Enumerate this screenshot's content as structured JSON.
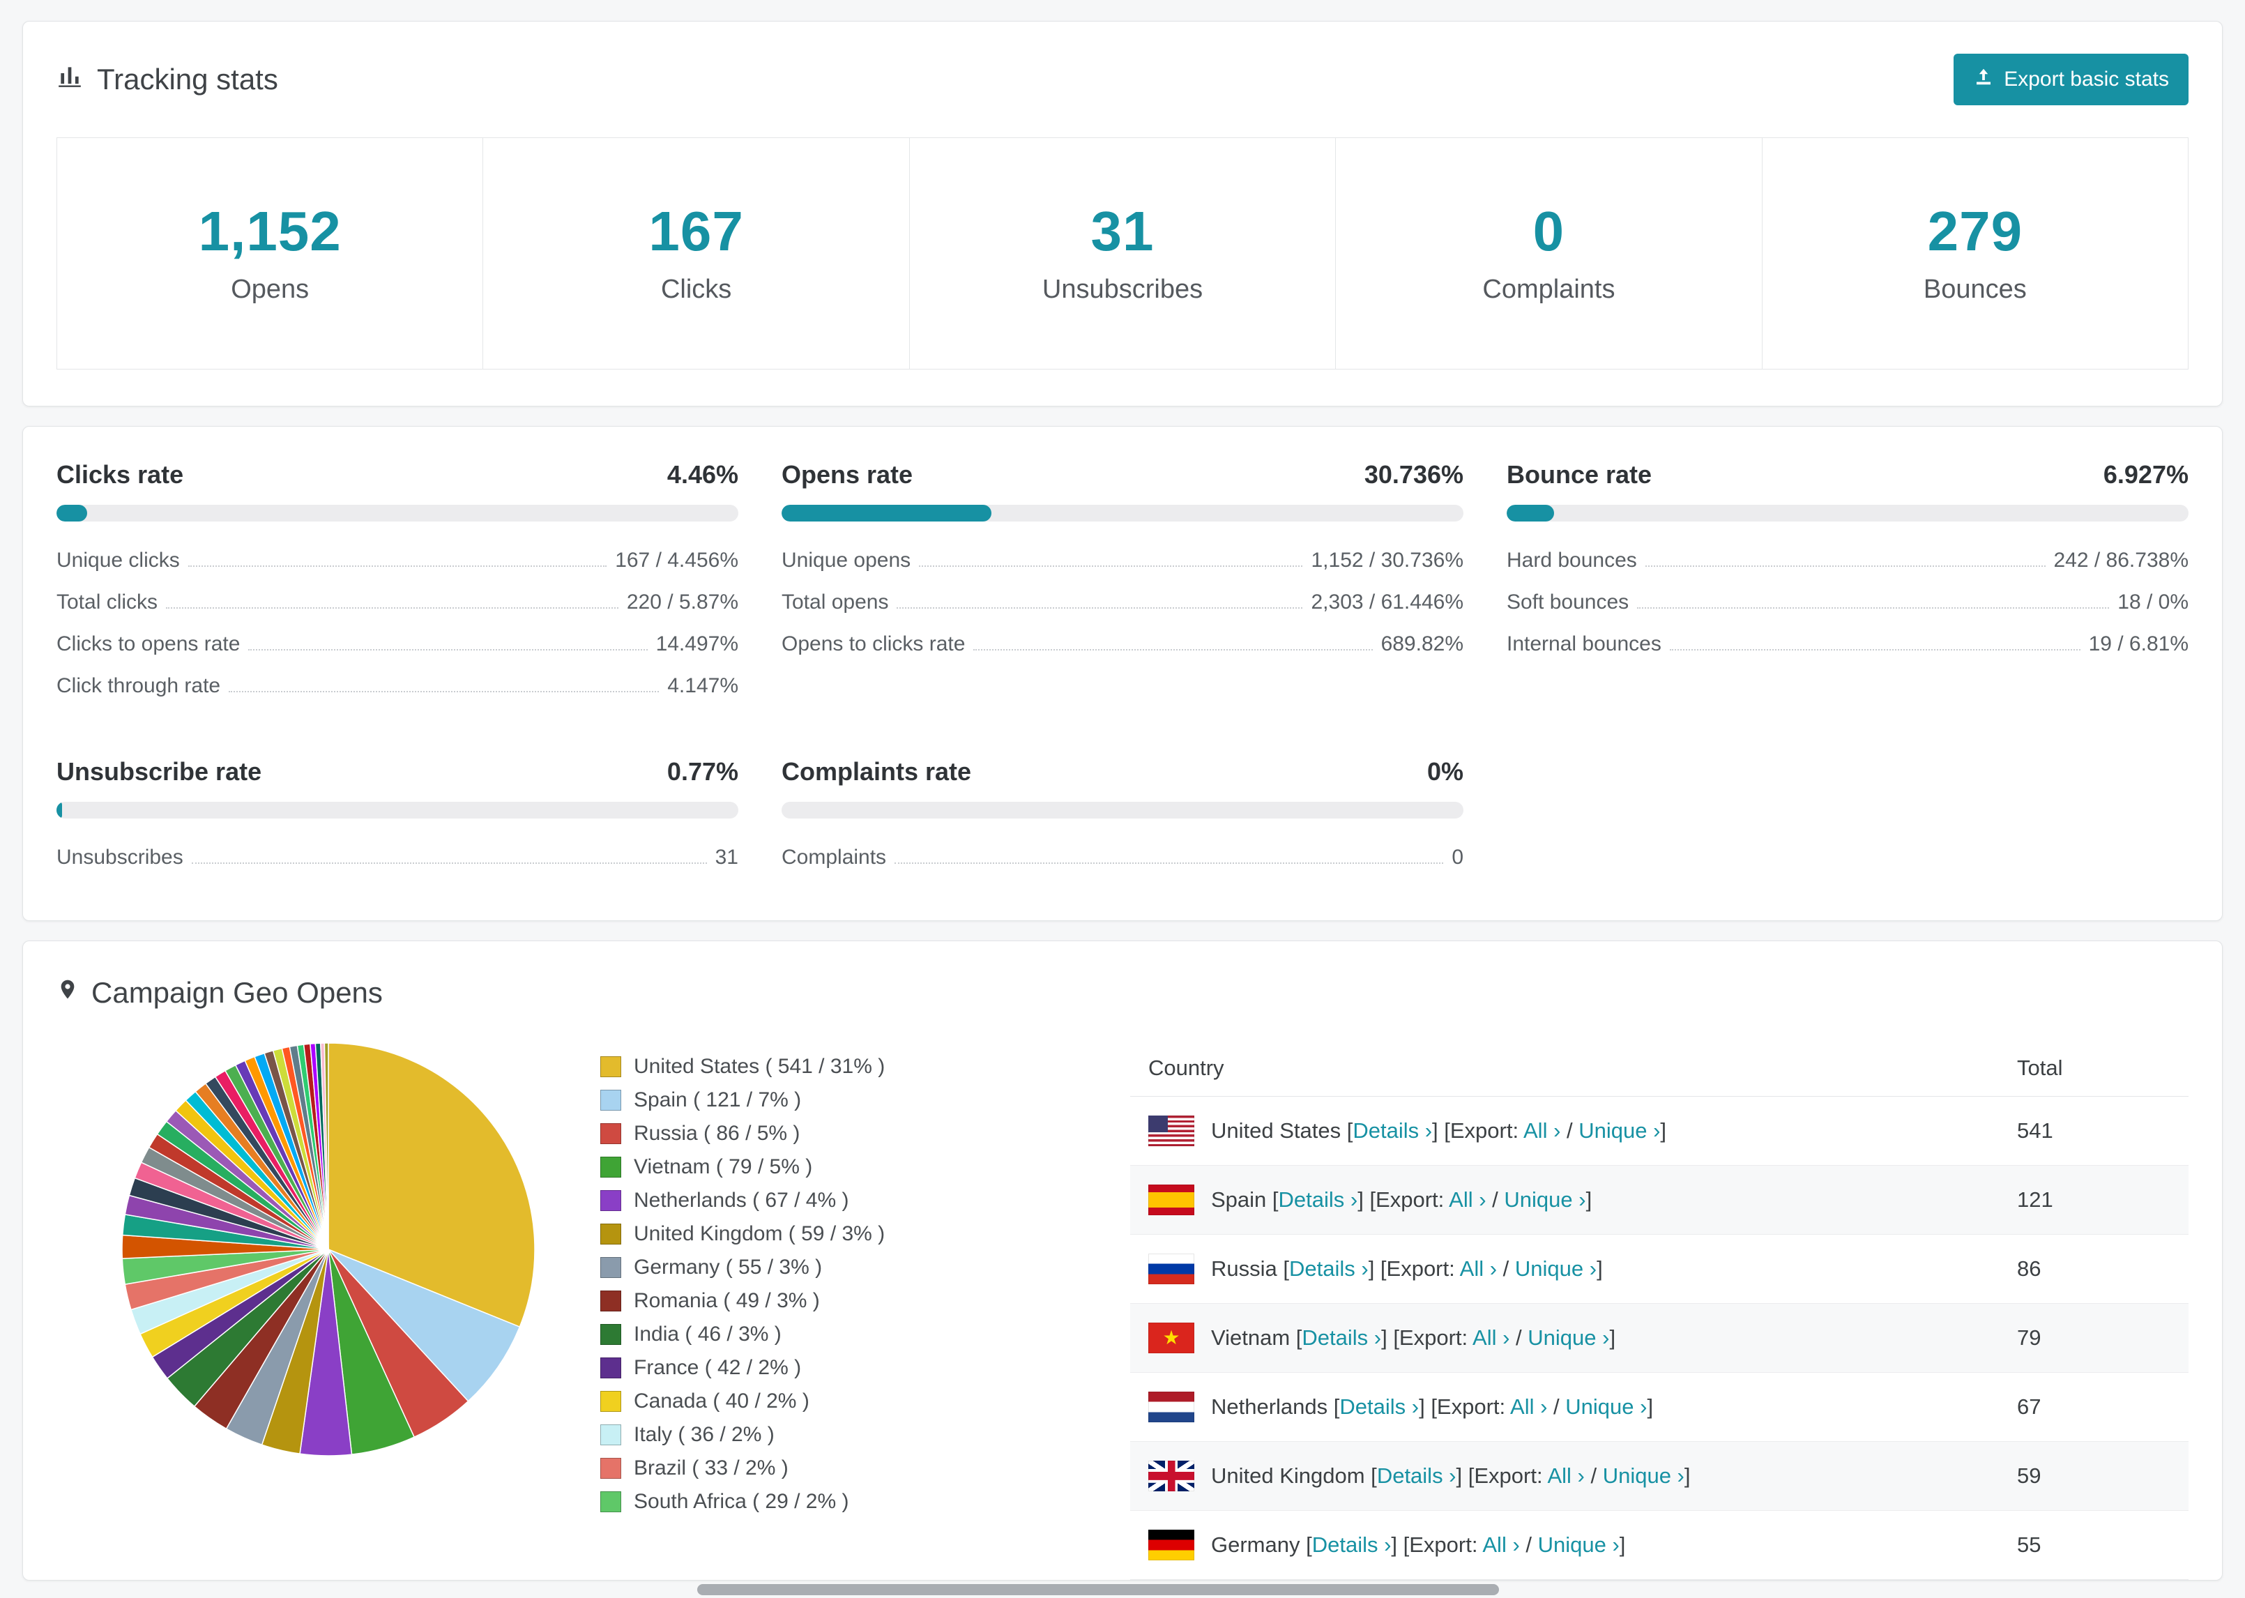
{
  "theme": {
    "accent": "#1791a3",
    "title_text": "#3f4347",
    "muted_text": "#5a5f64",
    "progress_track": "#ececee"
  },
  "icons": {
    "tracking_title": "bar-chart-icon",
    "export_button": "export-upload-icon",
    "geo_title": "location-pin-icon"
  },
  "tracking": {
    "title": "Tracking stats",
    "export_button": "Export basic stats",
    "stats": [
      {
        "value": "1,152",
        "label": "Opens"
      },
      {
        "value": "167",
        "label": "Clicks"
      },
      {
        "value": "31",
        "label": "Unsubscribes"
      },
      {
        "value": "0",
        "label": "Complaints"
      },
      {
        "value": "279",
        "label": "Bounces"
      }
    ]
  },
  "rates": {
    "clicks": {
      "title": "Clicks rate",
      "value": "4.46%",
      "pct": 4.46,
      "rows": [
        {
          "label": "Unique clicks",
          "value": "167 / 4.456%"
        },
        {
          "label": "Total clicks",
          "value": "220 / 5.87%"
        },
        {
          "label": "Clicks to opens rate",
          "value": "14.497%"
        },
        {
          "label": "Click through rate",
          "value": "4.147%"
        }
      ]
    },
    "opens": {
      "title": "Opens rate",
      "value": "30.736%",
      "pct": 30.736,
      "rows": [
        {
          "label": "Unique opens",
          "value": "1,152 / 30.736%"
        },
        {
          "label": "Total opens",
          "value": "2,303 / 61.446%"
        },
        {
          "label": "Opens to clicks rate",
          "value": "689.82%"
        }
      ]
    },
    "bounce": {
      "title": "Bounce rate",
      "value": "6.927%",
      "pct": 6.927,
      "rows": [
        {
          "label": "Hard bounces",
          "value": "242 / 86.738%"
        },
        {
          "label": "Soft bounces",
          "value": "18 / 0%"
        },
        {
          "label": "Internal bounces",
          "value": "19 / 6.81%"
        }
      ]
    },
    "unsubscribe": {
      "title": "Unsubscribe rate",
      "value": "0.77%",
      "pct": 0.77,
      "rows": [
        {
          "label": "Unsubscribes",
          "value": "31"
        }
      ]
    },
    "complaints": {
      "title": "Complaints rate",
      "value": "0%",
      "pct": 0,
      "rows": [
        {
          "label": "Complaints",
          "value": "0"
        }
      ]
    }
  },
  "geo": {
    "title": "Campaign Geo Opens",
    "table": {
      "headers": {
        "country": "Country",
        "total": "Total"
      },
      "links": {
        "details": "Details",
        "export": "Export:",
        "all": "All",
        "unique": "Unique",
        "chevron": "›"
      },
      "rows": [
        {
          "country": "United States",
          "total": "541",
          "flag": "us"
        },
        {
          "country": "Spain",
          "total": "121",
          "flag": "es"
        },
        {
          "country": "Russia",
          "total": "86",
          "flag": "ru"
        },
        {
          "country": "Vietnam",
          "total": "79",
          "flag": "vn"
        },
        {
          "country": "Netherlands",
          "total": "67",
          "flag": "nl"
        },
        {
          "country": "United Kingdom",
          "total": "59",
          "flag": "gb"
        },
        {
          "country": "Germany",
          "total": "55",
          "flag": "de"
        }
      ]
    }
  },
  "chart_data": {
    "type": "pie",
    "title": "Campaign Geo Opens",
    "legend_position": "right",
    "value_format": "name ( count / pct% )",
    "series": [
      {
        "name": "United States",
        "value": 541,
        "pct": 31,
        "color": "#e3bb2c"
      },
      {
        "name": "Spain",
        "value": 121,
        "pct": 7,
        "color": "#a8d3f0"
      },
      {
        "name": "Russia",
        "value": 86,
        "pct": 5,
        "color": "#cf4a41"
      },
      {
        "name": "Vietnam",
        "value": 79,
        "pct": 5,
        "color": "#3fa435"
      },
      {
        "name": "Netherlands",
        "value": 67,
        "pct": 4,
        "color": "#8a3fc6"
      },
      {
        "name": "United Kingdom",
        "value": 59,
        "pct": 3,
        "color": "#b5940f"
      },
      {
        "name": "Germany",
        "value": 55,
        "pct": 3,
        "color": "#8a9bac"
      },
      {
        "name": "Romania",
        "value": 49,
        "pct": 3,
        "color": "#8e2f24"
      },
      {
        "name": "India",
        "value": 46,
        "pct": 3,
        "color": "#2d7a33"
      },
      {
        "name": "France",
        "value": 42,
        "pct": 2,
        "color": "#5d2f8e"
      },
      {
        "name": "Canada",
        "value": 40,
        "pct": 2,
        "color": "#f0d01f"
      },
      {
        "name": "Italy",
        "value": 36,
        "pct": 2,
        "color": "#c8f0f5"
      },
      {
        "name": "Brazil",
        "value": 33,
        "pct": 2,
        "color": "#e57368"
      },
      {
        "name": "South Africa",
        "value": 29,
        "pct": 2,
        "color": "#5fc868"
      }
    ],
    "others": [
      {
        "pct": 1.8,
        "color": "#d35400"
      },
      {
        "pct": 1.6,
        "color": "#16a085"
      },
      {
        "pct": 1.5,
        "color": "#8e44ad"
      },
      {
        "pct": 1.4,
        "color": "#2c3e50"
      },
      {
        "pct": 1.3,
        "color": "#f06292"
      },
      {
        "pct": 1.3,
        "color": "#7f8c8d"
      },
      {
        "pct": 1.2,
        "color": "#c0392b"
      },
      {
        "pct": 1.2,
        "color": "#27ae60"
      },
      {
        "pct": 1.1,
        "color": "#9b59b6"
      },
      {
        "pct": 1.1,
        "color": "#f1c40f"
      },
      {
        "pct": 1.0,
        "color": "#00bcd4"
      },
      {
        "pct": 1.0,
        "color": "#e67e22"
      },
      {
        "pct": 0.9,
        "color": "#34495e"
      },
      {
        "pct": 0.9,
        "color": "#e91e63"
      },
      {
        "pct": 0.9,
        "color": "#4caf50"
      },
      {
        "pct": 0.8,
        "color": "#673ab7"
      },
      {
        "pct": 0.8,
        "color": "#ff9800"
      },
      {
        "pct": 0.8,
        "color": "#03a9f4"
      },
      {
        "pct": 0.7,
        "color": "#795548"
      },
      {
        "pct": 0.7,
        "color": "#cddc39"
      },
      {
        "pct": 0.6,
        "color": "#ff5722"
      },
      {
        "pct": 0.6,
        "color": "#607d8b"
      },
      {
        "pct": 0.5,
        "color": "#2ecc71"
      },
      {
        "pct": 0.5,
        "color": "#b71c1c"
      },
      {
        "pct": 0.4,
        "color": "#aa00ff"
      },
      {
        "pct": 0.4,
        "color": "#00695c"
      },
      {
        "pct": 0.3,
        "color": "#f8bbd0"
      },
      {
        "pct": 0.3,
        "color": "#9e9d24"
      }
    ]
  }
}
